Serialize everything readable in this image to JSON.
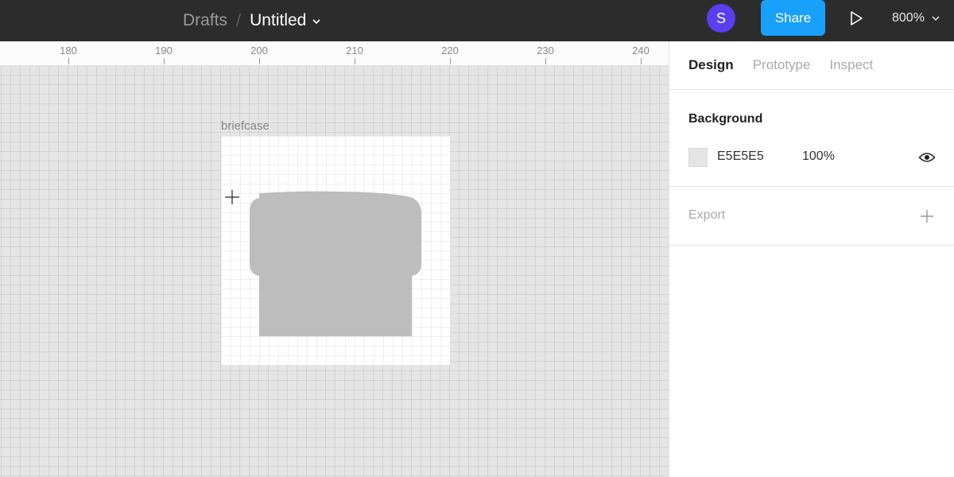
{
  "header": {
    "breadcrumb_parent": "Drafts",
    "breadcrumb_separator": "/",
    "file_name": "Untitled",
    "avatar_initial": "S",
    "share_label": "Share",
    "zoom_level": "800%",
    "icons": [
      "chevron-down-icon",
      "play-icon"
    ]
  },
  "ruler": {
    "ticks": [
      "180",
      "190",
      "200",
      "210",
      "220",
      "230",
      "240"
    ]
  },
  "canvas": {
    "frame_name": "briefcase",
    "frame_fill": "#ffffff",
    "shape_fill": "#bdbdbd"
  },
  "panel": {
    "tabs": [
      {
        "label": "Design",
        "active": true
      },
      {
        "label": "Prototype",
        "active": false
      },
      {
        "label": "Inspect",
        "active": false
      }
    ],
    "background": {
      "title": "Background",
      "hex": "E5E5E5",
      "opacity": "100%",
      "swatch_color": "#e5e5e5"
    },
    "export": {
      "title": "Export"
    }
  },
  "colors": {
    "topbar": "#2c2c2c",
    "accent": "#18a0fb",
    "avatar": "#5a3ef0"
  }
}
